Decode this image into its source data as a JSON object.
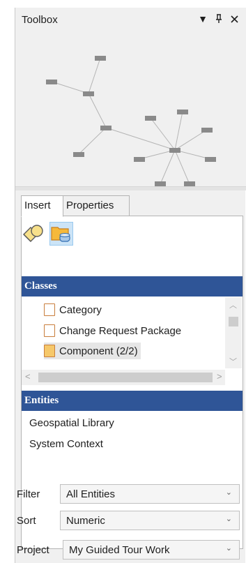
{
  "toolbox": {
    "title": "Toolbox",
    "dropdown_glyph": "▾",
    "pin_glyph": "📌",
    "close_glyph": "✕"
  },
  "tabs": [
    {
      "label": "Insert",
      "active": true
    },
    {
      "label": "Properties",
      "active": false
    }
  ],
  "tool_icons": [
    "shape-tool-icon",
    "folder-package-tool-icon"
  ],
  "classes": {
    "header": "Classes",
    "items": [
      {
        "label": "Category",
        "icon": "folder-outline-icon"
      },
      {
        "label": "Change Request Package",
        "icon": "folder-outline-icon"
      },
      {
        "label": "Component  (2/2)",
        "icon": "folder-filled-icon",
        "selected": true
      }
    ]
  },
  "entities": {
    "header": "Entities",
    "items": [
      "Geospatial Library",
      "System Context"
    ]
  },
  "filters": {
    "filter_label": "Filter",
    "filter_value": "All Entities",
    "sort_label": "Sort",
    "sort_value": "Numeric",
    "project_label": "Project",
    "project_value": "My Guided Tour Work"
  },
  "colors": {
    "section_header": "#2f5597",
    "node": "#8a8a8a",
    "edge": "#b4b4b4",
    "selected_tool": "#cce4f7"
  }
}
